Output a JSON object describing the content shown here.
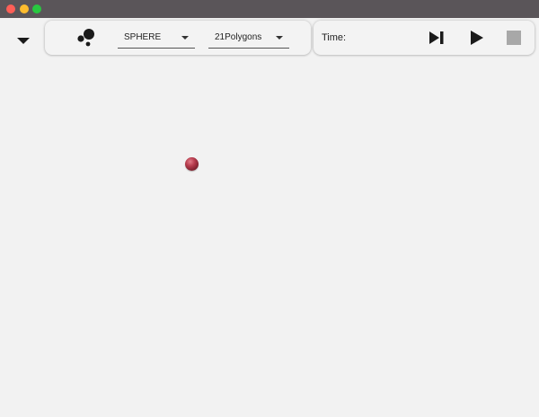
{
  "window": {
    "controls": [
      "close",
      "minimize",
      "zoom"
    ]
  },
  "toolbar": {
    "collapse_icon": "caret-down-icon",
    "shapes_icon": "circles-cluster-icon",
    "shape_dropdown": {
      "selected": "SPHERE"
    },
    "polygon_dropdown": {
      "selected": "21Polygons"
    }
  },
  "playback": {
    "time_label": "Time:",
    "time_value": "",
    "step_icon": "step-forward-icon",
    "play_icon": "play-icon",
    "stop_icon": "stop-icon"
  },
  "scene": {
    "object": "sphere",
    "color": "#b83e4f"
  },
  "colors": {
    "titlebar": "#5a5559",
    "background": "#f2f2f2",
    "close": "#ff5f57",
    "minimize": "#febc2e",
    "zoom": "#28c840"
  }
}
